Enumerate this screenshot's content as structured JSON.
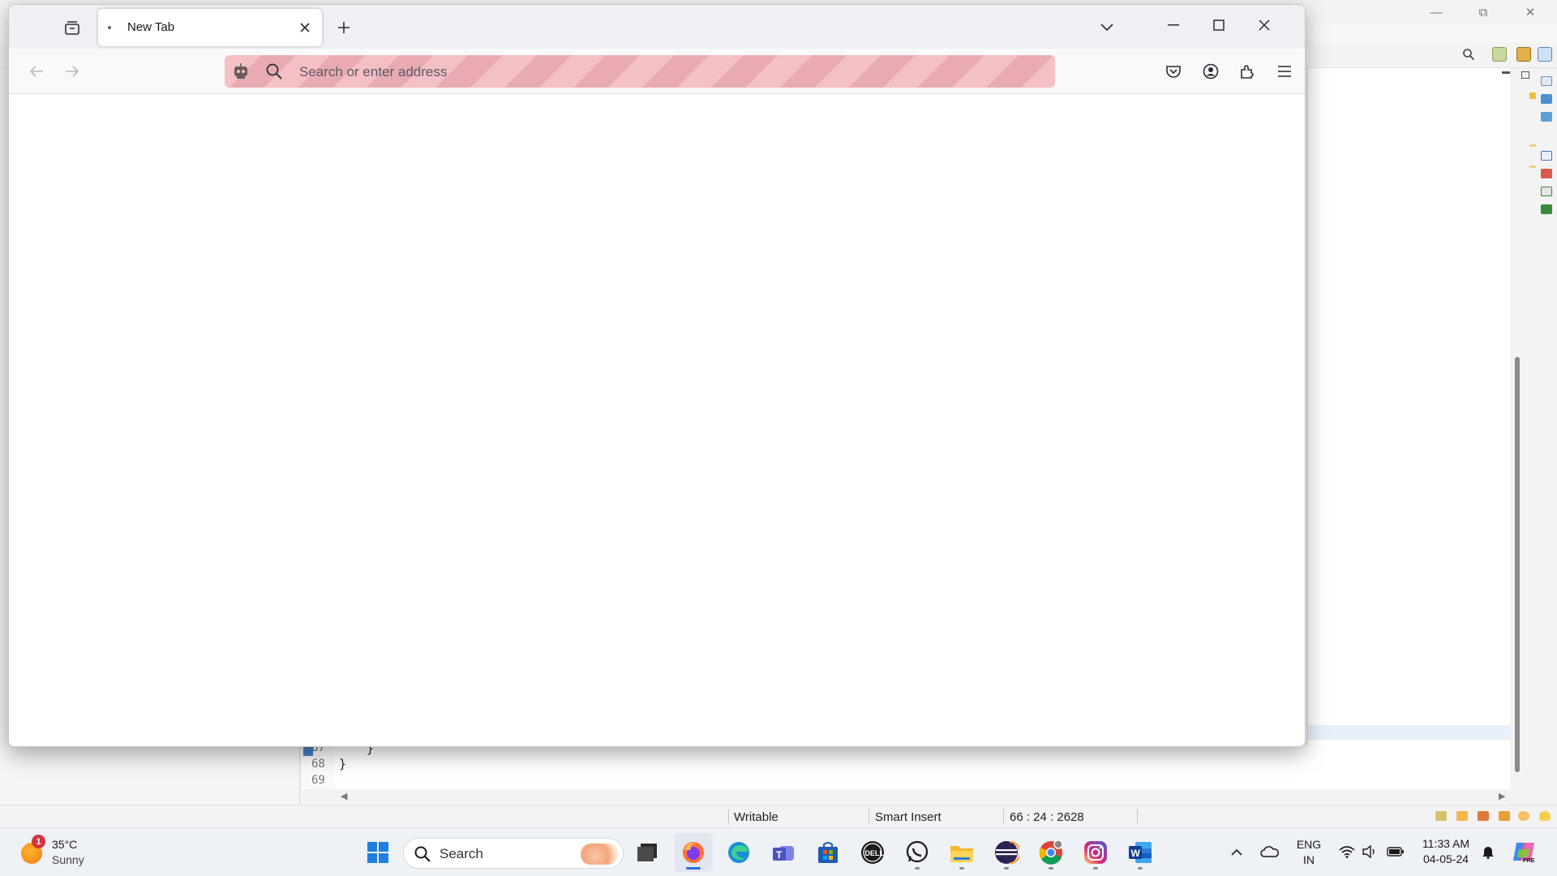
{
  "ide": {
    "editor": {
      "lines": [
        {
          "num": "67",
          "code": "}"
        },
        {
          "num": "68",
          "code": "}"
        },
        {
          "num": "69",
          "code": ""
        }
      ]
    },
    "status": {
      "writable": "Writable",
      "insert_mode": "Smart Insert",
      "position": "66 : 24 : 2628"
    }
  },
  "browser": {
    "tab": {
      "title": "New Tab"
    },
    "urlbar": {
      "placeholder": "Search or enter address"
    }
  },
  "taskbar": {
    "weather": {
      "badge": "1",
      "temp": "35°C",
      "condition": "Sunny"
    },
    "search_label": "Search",
    "apps": [
      "start",
      "file-explorer",
      "firefox",
      "edge",
      "teams",
      "microsoft-store",
      "dell",
      "whatsapp",
      "files",
      "eclipse",
      "chrome",
      "instagram",
      "word"
    ],
    "tray": {
      "lang_line1": "ENG",
      "lang_line2": "IN",
      "time": "11:33 AM",
      "date": "04-05-24"
    }
  },
  "colors": {
    "firefox_private_stripe": "#f4bfc5",
    "taskbar_bg": "#eef1f6",
    "accent_blue": "#2a6fdb"
  }
}
